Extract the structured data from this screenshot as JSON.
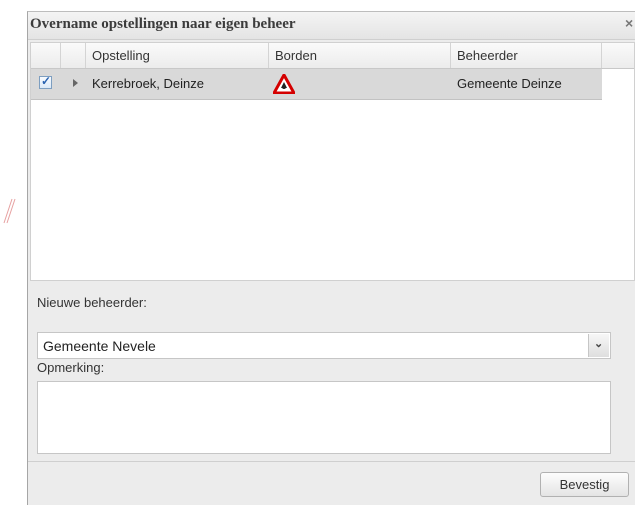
{
  "dialog": {
    "title": "Overname opstellingen naar eigen beheer",
    "close_label": "×"
  },
  "grid": {
    "columns": [
      "Opstelling",
      "Borden",
      "Beheerder"
    ],
    "rows": [
      {
        "checked": true,
        "opstelling": "Kerrebroek, Deinze",
        "borden_icon": "warning-triangle-sign-icon",
        "beheerder": "Gemeente Deinze"
      }
    ]
  },
  "form": {
    "nieuwe_beheerder_label": "Nieuwe beheerder:",
    "nieuwe_beheerder_value": "Gemeente Nevele",
    "opmerking_label": "Opmerking:",
    "opmerking_value": ""
  },
  "buttons": {
    "confirm_label": "Bevestig"
  },
  "colors": {
    "selected_row": "#d9d9d9",
    "sign_red": "#d40000"
  }
}
